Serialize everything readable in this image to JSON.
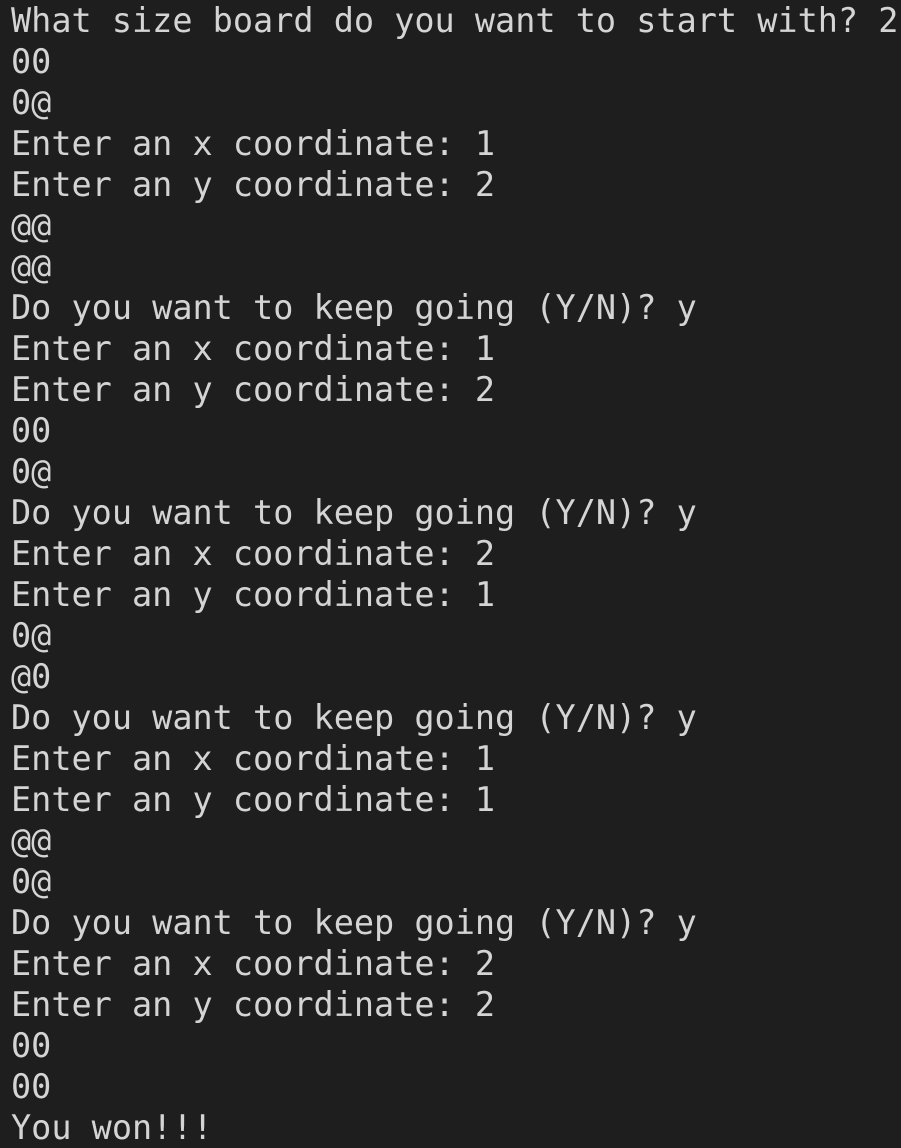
{
  "terminal": {
    "lines": [
      "What size board do you want to start with? 2",
      "00",
      "0@",
      "Enter an x coordinate: 1",
      "Enter an y coordinate: 2",
      "@@",
      "@@",
      "Do you want to keep going (Y/N)? y",
      "Enter an x coordinate: 1",
      "Enter an y coordinate: 2",
      "00",
      "0@",
      "Do you want to keep going (Y/N)? y",
      "Enter an x coordinate: 2",
      "Enter an y coordinate: 1",
      "0@",
      "@0",
      "Do you want to keep going (Y/N)? y",
      "Enter an x coordinate: 1",
      "Enter an y coordinate: 1",
      "@@",
      "0@",
      "Do you want to keep going (Y/N)? y",
      "Enter an x coordinate: 2",
      "Enter an y coordinate: 2",
      "00",
      "00",
      "You won!!!"
    ]
  }
}
